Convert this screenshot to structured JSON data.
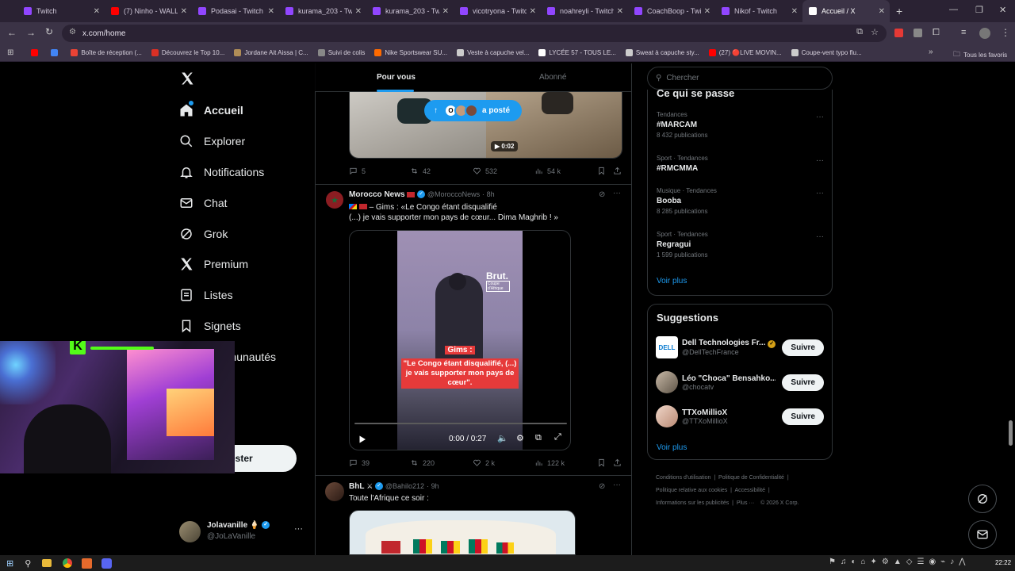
{
  "tabs": [
    {
      "label": "Twitch",
      "color": "#9146ff"
    },
    {
      "label": "(7) Ninho - WALL",
      "color": "#ff0000"
    },
    {
      "label": "Podasai - Twitch",
      "color": "#9146ff"
    },
    {
      "label": "kurama_203 - Twi",
      "color": "#9146ff"
    },
    {
      "label": "kurama_203 - Twi",
      "color": "#9146ff"
    },
    {
      "label": "vicotryona - Twitc",
      "color": "#9146ff"
    },
    {
      "label": "noahreyli - Twitch",
      "color": "#9146ff"
    },
    {
      "label": "CoachBoop - Twit",
      "color": "#9146ff"
    },
    {
      "label": "Nikof - Twitch",
      "color": "#9146ff"
    },
    {
      "label": "Accueil / X",
      "color": "#ffffff"
    }
  ],
  "url": "x.com/home",
  "bookmarks": [
    {
      "label": "",
      "color": "#ff0000"
    },
    {
      "label": "",
      "color": "#4285f4"
    },
    {
      "label": "Boîte de réception (...",
      "color": "#ea4335"
    },
    {
      "label": "Découvrez le Top 10...",
      "color": "#d93025"
    },
    {
      "label": "Jordane Ait Aissa | C...",
      "color": "#b08d57"
    },
    {
      "label": "Suivi de colis",
      "color": "#888888"
    },
    {
      "label": "Nike Sportswear SU...",
      "color": "#ff6a00"
    },
    {
      "label": "Veste à capuche vel...",
      "color": "#cccccc"
    },
    {
      "label": "LYCÉE 57 - TOUS LE...",
      "color": "#ffffff"
    },
    {
      "label": "Sweat à capuche sty...",
      "color": "#cccccc"
    },
    {
      "label": "(27) 🔴LIVE MOVIN...",
      "color": "#ff0000"
    },
    {
      "label": "Coupe-vent typo flu...",
      "color": "#cccccc"
    }
  ],
  "all_bookmarks": "Tous les favoris",
  "nav": [
    {
      "label": "Accueil",
      "icon": "home-icon"
    },
    {
      "label": "Explorer",
      "icon": "search-icon"
    },
    {
      "label": "Notifications",
      "icon": "bell-icon"
    },
    {
      "label": "Chat",
      "icon": "mail-icon"
    },
    {
      "label": "Grok",
      "icon": "grok-icon"
    },
    {
      "label": "Premium",
      "icon": "x-logo-icon"
    },
    {
      "label": "Listes",
      "icon": "list-icon"
    },
    {
      "label": "Signets",
      "icon": "bookmark-icon"
    },
    {
      "label": "Communautés",
      "icon": "community-icon"
    }
  ],
  "post_button": "Poster",
  "account": {
    "name": "Jolavanille 🍦",
    "handle": "@JoLaVanille"
  },
  "feed_tabs": [
    "Pour vous",
    "Abonné"
  ],
  "new_posts_pill": "a posté",
  "post1": {
    "duration": "0:02",
    "replies": "5",
    "reposts": "42",
    "likes": "532",
    "views": "54 k"
  },
  "post2": {
    "author": "Morocco News",
    "handle": "@MoroccoNews",
    "time": "8h",
    "text1": "– Gims : «Le Congo étant disqualifié",
    "text2": "(...) je vais supporter mon pays de cœur... Dima Maghrib ! »",
    "brand": "Brut.",
    "brand_sub": "Coupe d'Afrique",
    "caption_head": "Gims :",
    "caption": "\"Le Congo étant disqualifié, (...) je vais supporter mon pays de cœur\".",
    "time_display": "0:00 / 0:27",
    "replies": "39",
    "reposts": "220",
    "likes": "2 k",
    "views": "122 k"
  },
  "post3": {
    "author": "BhL",
    "handle": "@Bahilo212",
    "time": "9h",
    "text": "Toute l'Afrique ce soir :"
  },
  "search_placeholder": "Chercher",
  "trends_title": "Ce qui se passe",
  "trends": [
    {
      "category": "Tendances",
      "name": "#MARCAM",
      "posts": "8 432 publications"
    },
    {
      "category": "Sport · Tendances",
      "name": "#RMCMMA",
      "posts": ""
    },
    {
      "category": "Musique · Tendances",
      "name": "Booba",
      "posts": "8 285 publications"
    },
    {
      "category": "Sport · Tendances",
      "name": "Regragui",
      "posts": "1 599 publications"
    }
  ],
  "show_more": "Voir plus",
  "suggestions_title": "Suggestions",
  "suggestions": [
    {
      "name": "Dell Technologies Fr...",
      "handle": "@DellTechFrance",
      "button": "Suivre"
    },
    {
      "name": "Léo \"Choca\" Bensahko...",
      "handle": "@chocatv",
      "button": "Suivre"
    },
    {
      "name": "TTXoMillioX",
      "handle": "@TTXoMillioX",
      "button": "Suivre"
    }
  ],
  "footer": [
    "Conditions d'utilisation",
    "Politique de Confidentialité",
    "Politique relative aux cookies",
    "Accessibilité",
    "Informations sur les publicités",
    "Plus ···",
    "© 2026 X Corp."
  ],
  "clock": "22:22"
}
